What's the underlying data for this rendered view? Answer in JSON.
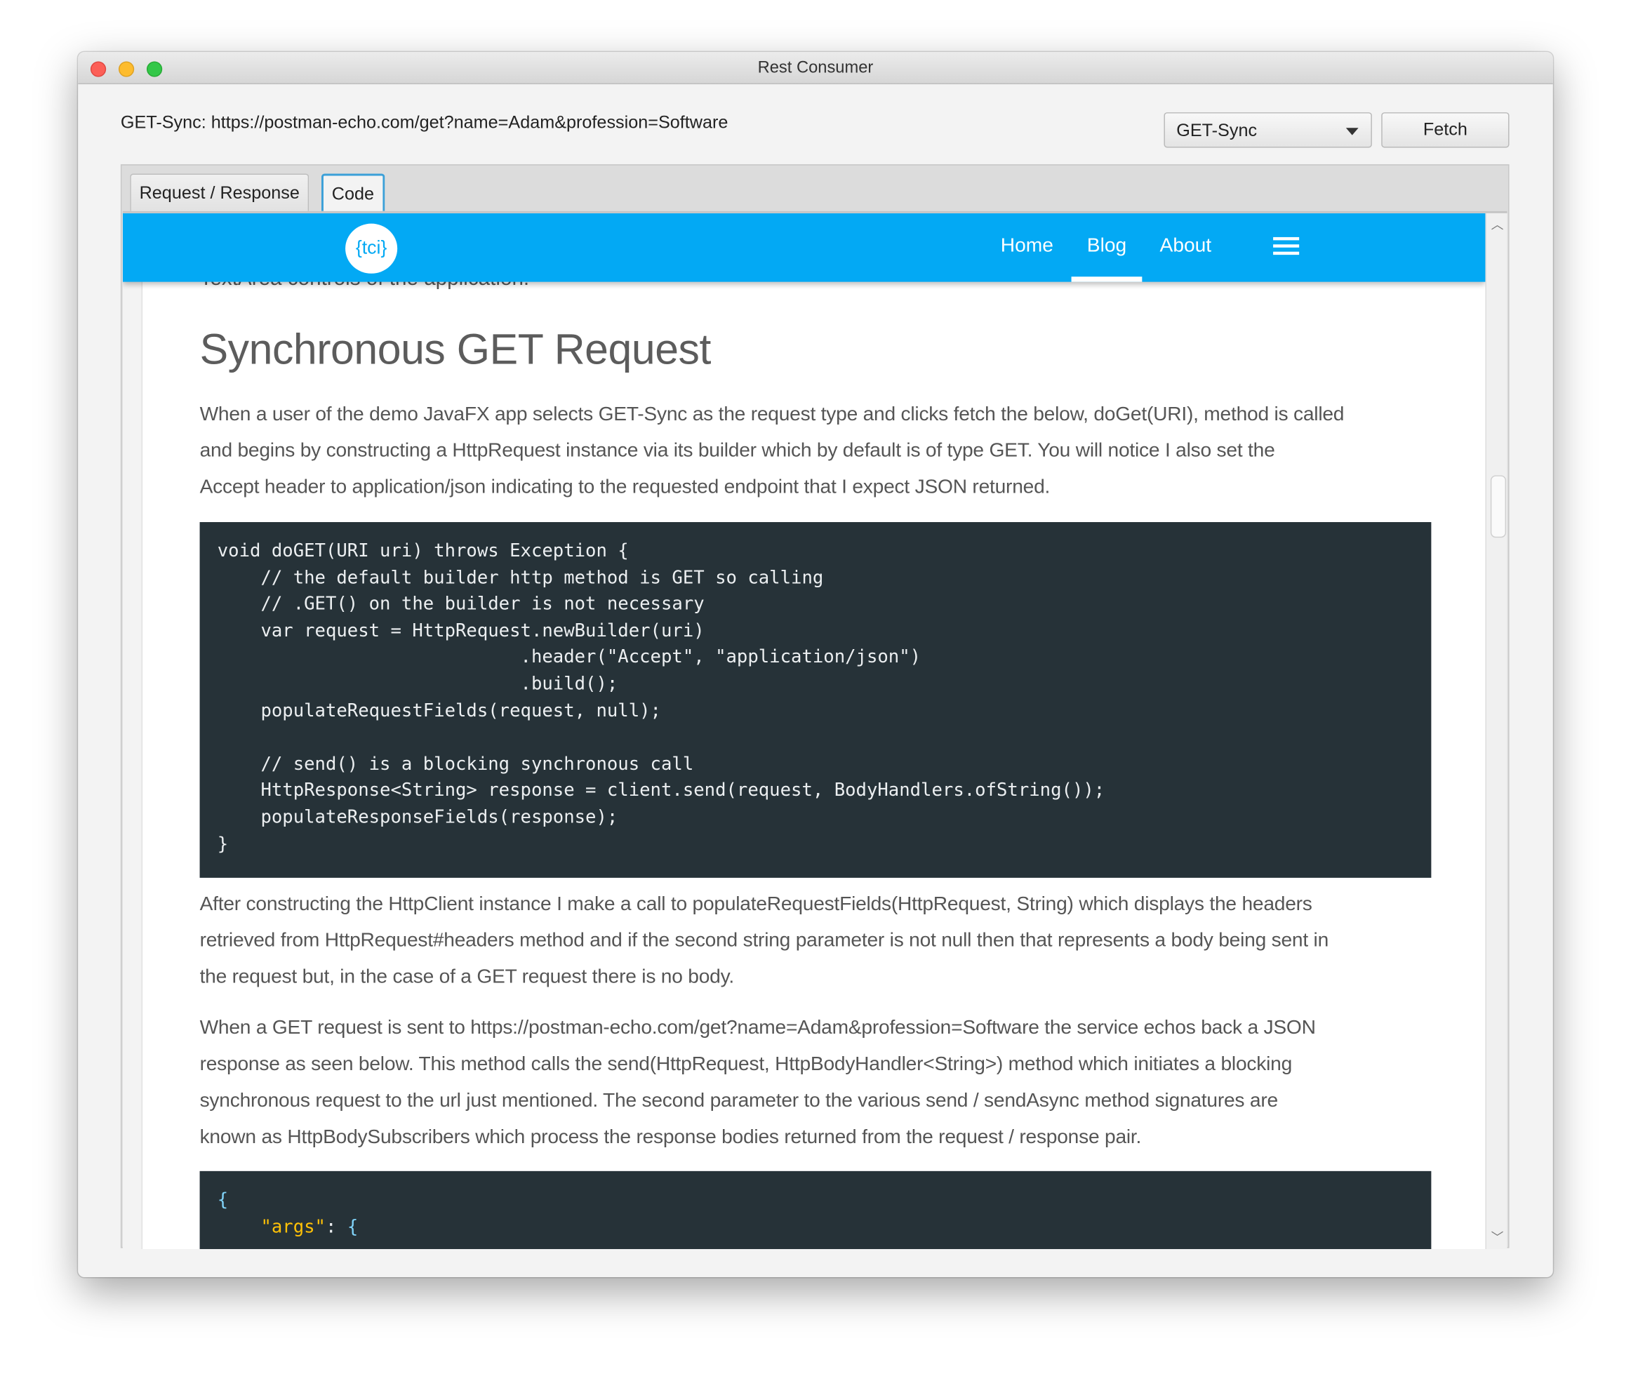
{
  "window": {
    "title": "Rest Consumer"
  },
  "toolbar": {
    "url_label": "GET-Sync: https://postman-echo.com/get?name=Adam&profession=Software",
    "method_select": "GET-Sync",
    "fetch_label": "Fetch"
  },
  "tabs": [
    {
      "label": "Request / Response"
    },
    {
      "label": "Code"
    }
  ],
  "site_nav": {
    "logo": "{tci}",
    "links": [
      "Home",
      "Blog",
      "About"
    ],
    "active": "Blog"
  },
  "article": {
    "clipped_text": "TextArea controls of the application.",
    "heading": "Synchronous GET Request",
    "para1": [
      "When a user of the demo JavaFX app selects GET-Sync as the request type and clicks fetch the below, doGet(URI), method is called",
      "and begins by constructing a HttpRequest instance via its builder which by default is of type GET. You will notice I also set the",
      "Accept header to application/json indicating to the requested endpoint that I expect JSON returned."
    ],
    "code1": "void doGET(URI uri) throws Exception {\n    // the default builder http method is GET so calling\n    // .GET() on the builder is not necessary\n    var request = HttpRequest.newBuilder(uri)\n                            .header(\"Accept\", \"application/json\")\n                            .build();\n    populateRequestFields(request, null);\n\n    // send() is a blocking synchronous call\n    HttpResponse<String> response = client.send(request, BodyHandlers.ofString());\n    populateResponseFields(response);\n}",
    "para2": [
      "After constructing the HttpClient instance I make a call to populateRequestFields(HttpRequest, String) which displays the headers",
      "retrieved from HttpRequest#headers method and if the second string parameter is not null then that represents a body being sent in",
      "the request but, in the case of a GET request there is no body."
    ],
    "para3": [
      "When a GET request is sent to https://postman-echo.com/get?name=Adam&profession=Software the service echos back a JSON",
      "response as seen below. This method calls the send(HttpRequest, HttpBodyHandler<String>) method which initiates a blocking",
      "synchronous request to the url just mentioned. The second parameter to the various send / sendAsync method signatures are",
      "known as HttpBodySubscribers which process the response bodies returned from the request / response pair."
    ],
    "code2": {
      "open": "{",
      "key": "\"args\"",
      "colon": ": ",
      "brace": "{"
    }
  },
  "colors": {
    "nav": "#03a9f4",
    "code_bg": "#263238",
    "json_key": "#ffc107",
    "json_punct": "#81d4fa"
  }
}
